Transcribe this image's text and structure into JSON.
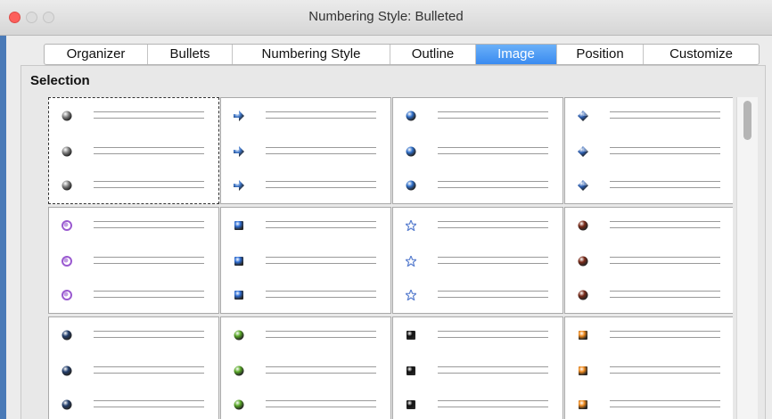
{
  "window": {
    "title": "Numbering Style: Bulleted"
  },
  "tabs": [
    {
      "label": "Organizer"
    },
    {
      "label": "Bullets"
    },
    {
      "label": "Numbering Style"
    },
    {
      "label": "Outline"
    },
    {
      "label": "Image",
      "active": true
    },
    {
      "label": "Position"
    },
    {
      "label": "Customize"
    }
  ],
  "section": {
    "selection_label": "Selection"
  },
  "bullet_grid": {
    "selected_index": 0,
    "items": [
      {
        "icon": "gray-sphere-bullet-icon",
        "shape": "sphere",
        "color": "#8a8a8a"
      },
      {
        "icon": "blue-arrow-bullet-icon",
        "shape": "arrow",
        "color": "#3b74c8"
      },
      {
        "icon": "blue-sphere-bullet-icon",
        "shape": "sphere",
        "color": "#2f6fc9"
      },
      {
        "icon": "blue-diamond-arrow-bullet-icon",
        "shape": "diamond",
        "color": "#2b5eb2"
      },
      {
        "icon": "purple-orb-bullet-icon",
        "shape": "orb",
        "color": "#9a5ad0"
      },
      {
        "icon": "blue-square-bullet-icon",
        "shape": "square",
        "color": "#2f6fd6"
      },
      {
        "icon": "blue-star-bullet-icon",
        "shape": "star",
        "color": "#5a7fcf"
      },
      {
        "icon": "dark-red-sphere-bullet-icon",
        "shape": "sphere",
        "color": "#7a2a18"
      },
      {
        "icon": "navy-sphere-bullet-icon",
        "shape": "sphere",
        "color": "#24406e"
      },
      {
        "icon": "green-sphere-bullet-icon",
        "shape": "sphere",
        "color": "#5aaa28"
      },
      {
        "icon": "black-square-bullet-icon",
        "shape": "square",
        "color": "#111111"
      },
      {
        "icon": "orange-square-bullet-icon",
        "shape": "square",
        "color": "#f08a1c"
      }
    ]
  }
}
